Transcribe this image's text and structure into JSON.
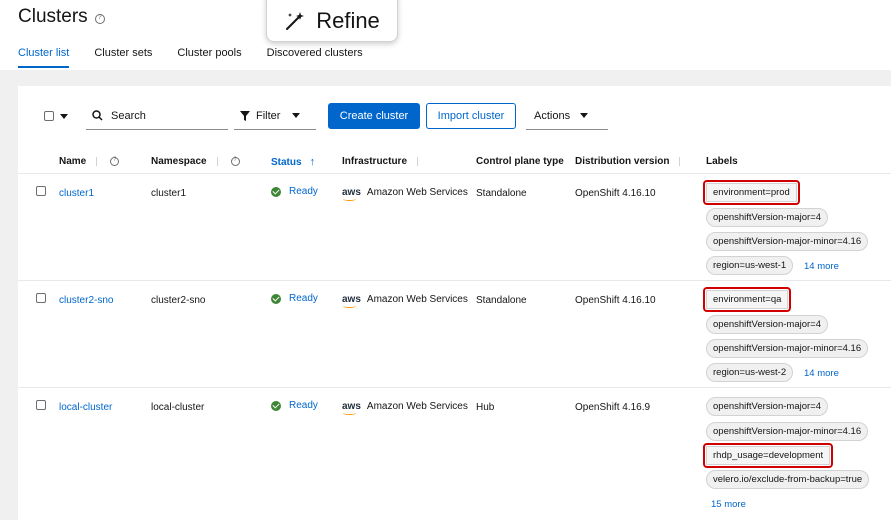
{
  "page": {
    "title": "Clusters"
  },
  "refine": {
    "label": "Refine"
  },
  "tabs": [
    {
      "label": "Cluster list",
      "active": true
    },
    {
      "label": "Cluster sets"
    },
    {
      "label": "Cluster pools"
    },
    {
      "label": "Discovered clusters"
    }
  ],
  "toolbar": {
    "search_placeholder": "Search",
    "filter_label": "Filter",
    "create_label": "Create cluster",
    "import_label": "Import cluster",
    "actions_label": "Actions"
  },
  "columns": {
    "name": "Name",
    "namespace": "Namespace",
    "status": "Status",
    "infrastructure": "Infrastructure",
    "control_plane": "Control plane type",
    "distribution": "Distribution version",
    "labels": "Labels"
  },
  "rows": [
    {
      "name": "cluster1",
      "namespace": "cluster1",
      "status": "Ready",
      "infra_logo": "aws",
      "infrastructure": "Amazon Web Services",
      "control_plane": "Standalone",
      "distribution": "OpenShift 4.16.10",
      "labels": [
        "environment=prod",
        "openshiftVersion-major=4",
        "openshiftVersion-major-minor=4.16",
        "region=us-west-1"
      ],
      "highlighted_label_index": 0,
      "more": "14 more"
    },
    {
      "name": "cluster2-sno",
      "namespace": "cluster2-sno",
      "status": "Ready",
      "infra_logo": "aws",
      "infrastructure": "Amazon Web Services",
      "control_plane": "Standalone",
      "distribution": "OpenShift 4.16.10",
      "labels": [
        "environment=qa",
        "openshiftVersion-major=4",
        "openshiftVersion-major-minor=4.16",
        "region=us-west-2"
      ],
      "highlighted_label_index": 0,
      "more": "14 more"
    },
    {
      "name": "local-cluster",
      "namespace": "local-cluster",
      "status": "Ready",
      "infra_logo": "aws",
      "infrastructure": "Amazon Web Services",
      "control_plane": "Hub",
      "distribution": "OpenShift 4.16.9",
      "labels": [
        "openshiftVersion-major=4",
        "openshiftVersion-major-minor=4.16",
        "rhdp_usage=development",
        "velero.io/exclude-from-backup=true"
      ],
      "highlighted_label_index": 2,
      "more": "15 more"
    }
  ],
  "colors": {
    "accent": "#0066cc",
    "ready": "#3e8635",
    "highlight": "#d00000"
  }
}
